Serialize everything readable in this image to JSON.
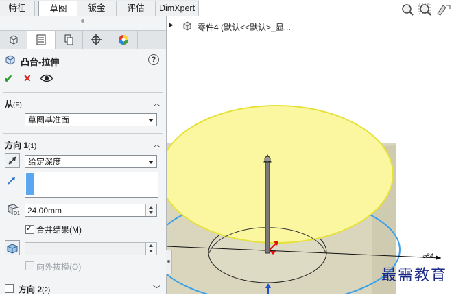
{
  "tabs": [
    "特征",
    "草图",
    "钣金",
    "评估",
    "DimXpert"
  ],
  "active_tab": 1,
  "feature": {
    "title": "凸台-拉伸",
    "help_label": "?",
    "ok_symbol": "✔",
    "cancel_symbol": "✕"
  },
  "from_section": {
    "title": "从",
    "shortcut": "(F)",
    "start_condition": "草图基准面"
  },
  "direction1": {
    "title": "方向 1",
    "shortcut": "(1)",
    "end_condition": "给定深度",
    "depth": "24.00mm",
    "merge_label": "合并结果(M)",
    "merge_checked": true,
    "draft_outward_label": "向外拔模(O)",
    "draft_outward_checked": false
  },
  "direction2": {
    "title": "方向 2",
    "shortcut": "(2)",
    "checked": false
  },
  "feature_tree": {
    "item": "零件4  (默认<<默认>_显..."
  },
  "dimension_label": "⌀84",
  "watermark": "最需教育",
  "colors": {
    "cap_fill": "#fbf7a0",
    "cap_edge": "#e6e23a",
    "body_fill": "#d9d6bd",
    "silhouette_blue": "#3aa0ea",
    "ok_green": "#2f9a2f",
    "cancel_red": "#d82222",
    "arrow_red": "#e01010"
  },
  "icons": [
    "feature-manager-icon",
    "property-manager-icon",
    "configuration-manager-icon",
    "dimxpert-manager-icon",
    "display-manager-icon",
    "extrude-boss-icon",
    "help-icon",
    "ok-check-icon",
    "cancel-x-icon",
    "preview-eye-icon",
    "reverse-direction-icon",
    "direction-vector-icon",
    "depth-icon",
    "draft-icon",
    "part-icon",
    "zoom-to-fit-icon",
    "zoom-to-area-icon",
    "previous-view-icon"
  ]
}
